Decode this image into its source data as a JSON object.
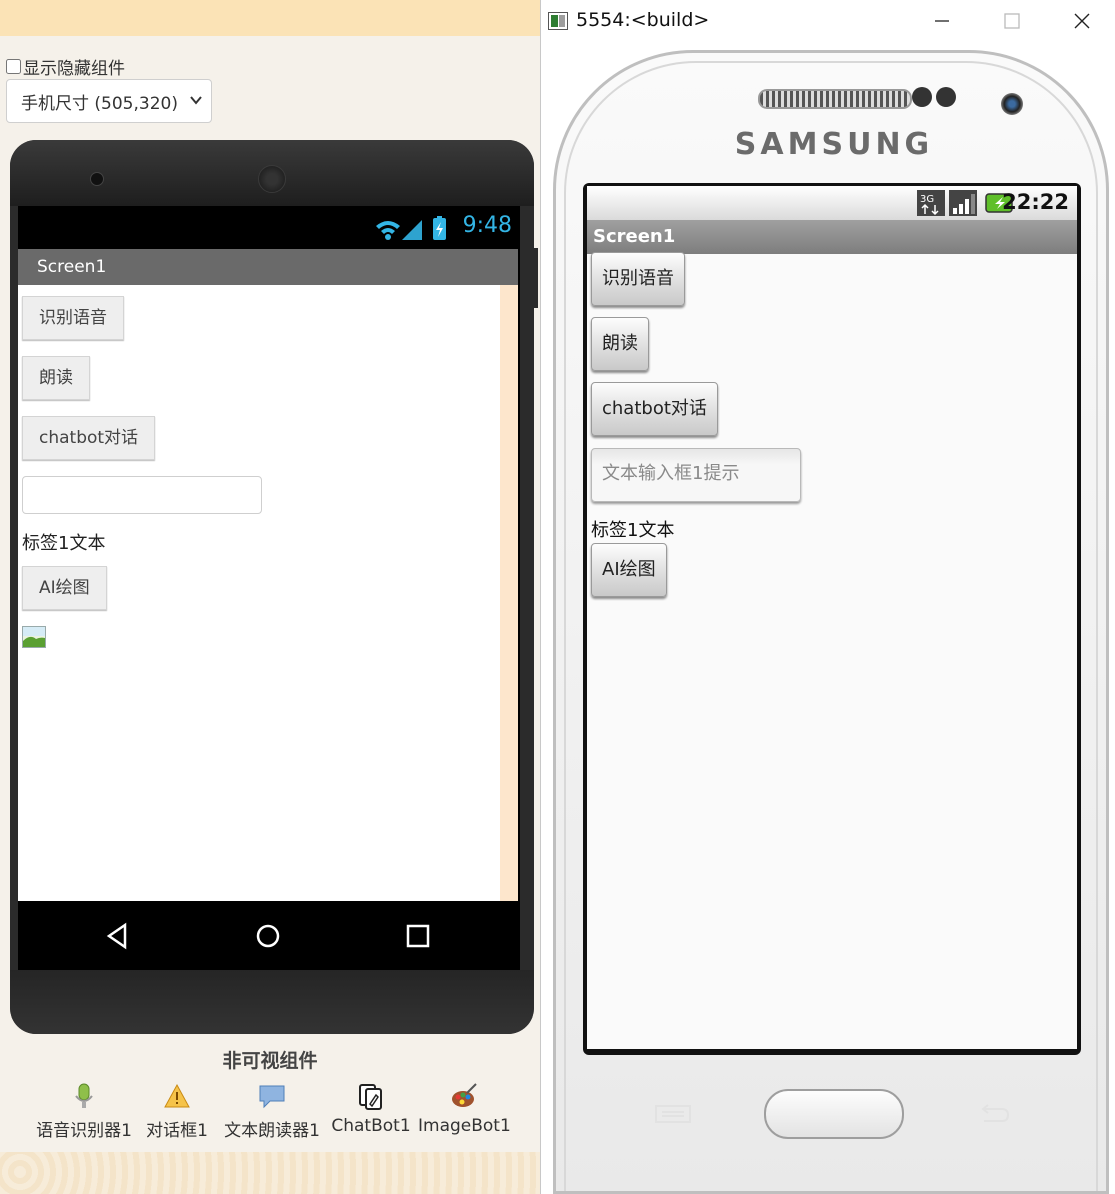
{
  "designer": {
    "show_hidden_label": "显示隐藏组件",
    "size_select": "手机尺寸 (505,320)",
    "statusbar_time": "9:48",
    "screen_title": "Screen1",
    "buttons": [
      "识别语音",
      "朗读",
      "chatbot对话",
      "AI绘图"
    ],
    "textbox_value": "",
    "label_text": "标签1文本",
    "nonvisible_title": "非可视组件",
    "nonvisible": [
      {
        "label": "语音识别器1",
        "icon": "microphone-icon"
      },
      {
        "label": "对话框1",
        "icon": "warning-icon"
      },
      {
        "label": "文本朗读器1",
        "icon": "speech-bubble-icon"
      },
      {
        "label": "ChatBot1",
        "icon": "chatbot-icon"
      },
      {
        "label": "ImageBot1",
        "icon": "paint-palette-icon"
      }
    ]
  },
  "emulator": {
    "window_title": "5554:<build>",
    "brand": "SAMSUNG",
    "statusbar_time": "22:22",
    "screen_title": "Screen1",
    "buttons": [
      "识别语音",
      "朗读",
      "chatbot对话",
      "AI绘图"
    ],
    "textbox_hint": "文本输入框1提示",
    "label_text": "标签1文本"
  },
  "colors": {
    "designer_titlebar": "#6a6a6a",
    "status_time_blue": "#33b5e5",
    "top_band": "#fbe3b6",
    "right_strip": "#fde6cc"
  }
}
